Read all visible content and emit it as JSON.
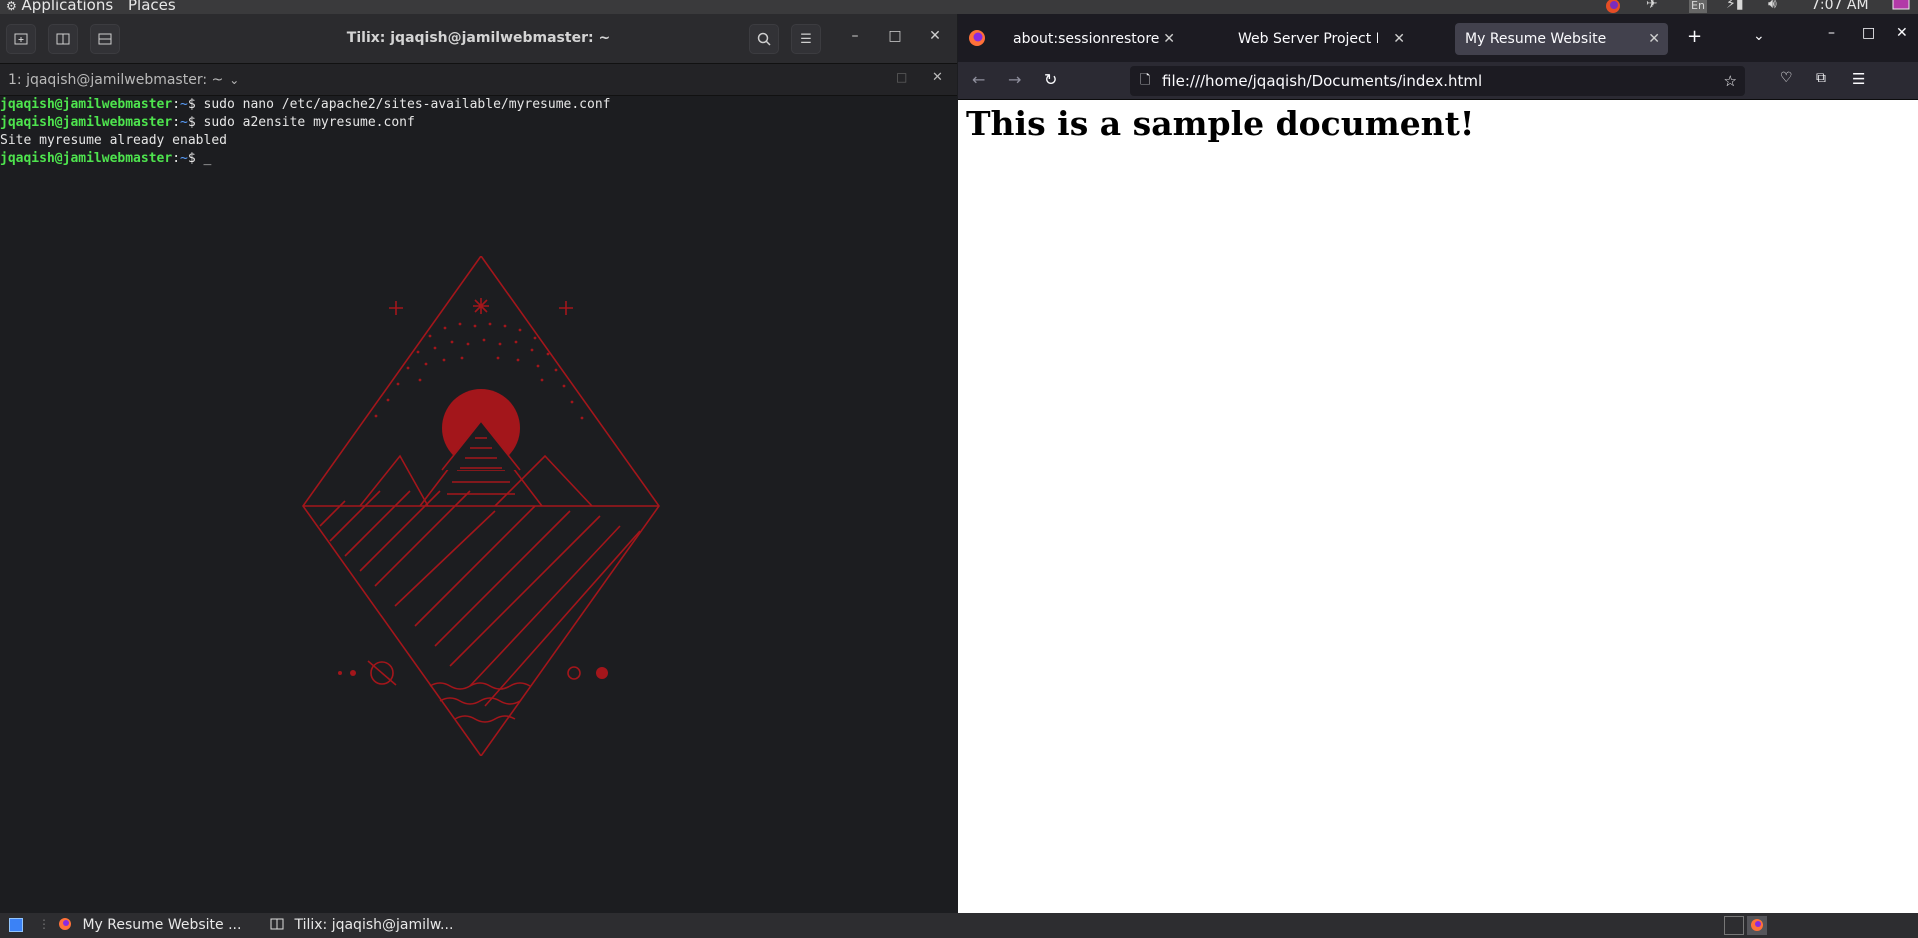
{
  "top_panel": {
    "applications_label": "Applications",
    "places_label": "Places",
    "keyboard_layout": "En",
    "clock": "7:07 AM"
  },
  "tilix": {
    "title": "Tilix: jqaqish@jamilwebmaster: ~",
    "session_label": "1: jqaqish@jamilwebmaster: ~",
    "terminal_lines": [
      {
        "user": "jqaqish@jamilwebmaster",
        "sep": ":",
        "path": "~",
        "sym": "$ ",
        "cmd": "sudo nano /etc/apache2/sites-available/myresume.conf"
      },
      {
        "user": "jqaqish@jamilwebmaster",
        "sep": ":",
        "path": "~",
        "sym": "$ ",
        "cmd": "sudo a2ensite myresume.conf"
      },
      {
        "output": "Site myresume already enabled"
      },
      {
        "user": "jqaqish@jamilwebmaster",
        "sep": ":",
        "path": "~",
        "sym": "$ ",
        "cmd": "_"
      }
    ],
    "colors": {
      "prompt_user": "#4ee44e",
      "art_red": "#a3161b"
    }
  },
  "firefox": {
    "tabs": [
      {
        "label": "about:sessionrestore",
        "active": false
      },
      {
        "label": "Web Server Project Deliverables",
        "active": false
      },
      {
        "label": "My Resume Website",
        "active": true
      }
    ],
    "url": "file:///home/jqaqish/Documents/index.html",
    "page_heading": "This is a sample document!"
  },
  "taskbar": {
    "items": [
      {
        "label": "My Resume Website ...",
        "icon": "firefox-icon"
      },
      {
        "label": "Tilix: jqaqish@jamilw...",
        "icon": "tilix-icon"
      }
    ]
  }
}
